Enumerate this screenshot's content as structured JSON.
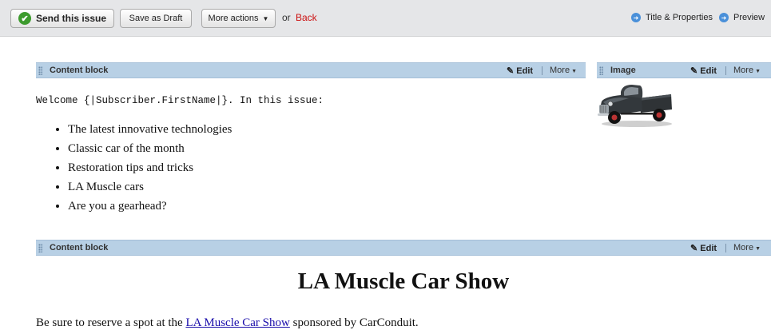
{
  "toolbar": {
    "send_label": "Send this issue",
    "draft_label": "Save as Draft",
    "more_label": "More actions",
    "or_text": "or",
    "back_label": "Back",
    "title_props_label": "Title & Properties",
    "preview_label": "Preview"
  },
  "blocks": [
    {
      "title": "Content block",
      "edit_label": "Edit",
      "more_label": "More"
    },
    {
      "title": "Image",
      "edit_label": "Edit",
      "more_label": "More"
    },
    {
      "title": "Content block",
      "edit_label": "Edit",
      "more_label": "More"
    }
  ],
  "content1": {
    "welcome": "Welcome {|Subscriber.FirstName|}. In this issue:",
    "items": [
      "The latest innovative technologies",
      "Classic car of the month",
      "Restoration tips and tricks",
      "LA Muscle cars",
      "Are you a gearhead?"
    ]
  },
  "image_block": {
    "icon": "classic-pickup-truck-image"
  },
  "content3": {
    "heading": "LA Muscle Car Show",
    "text_before": "Be sure to reserve a spot at the ",
    "link_text": "LA Muscle Car Show",
    "text_after": " sponsored by CarConduit."
  },
  "colors": {
    "toolbar_bg": "#e5e6e8",
    "block_header_bg": "#b8d0e5",
    "send_check": "#3d9b2e",
    "back_link": "#cc1111",
    "info_icon": "#4a90d9",
    "link": "#1a0dab"
  }
}
